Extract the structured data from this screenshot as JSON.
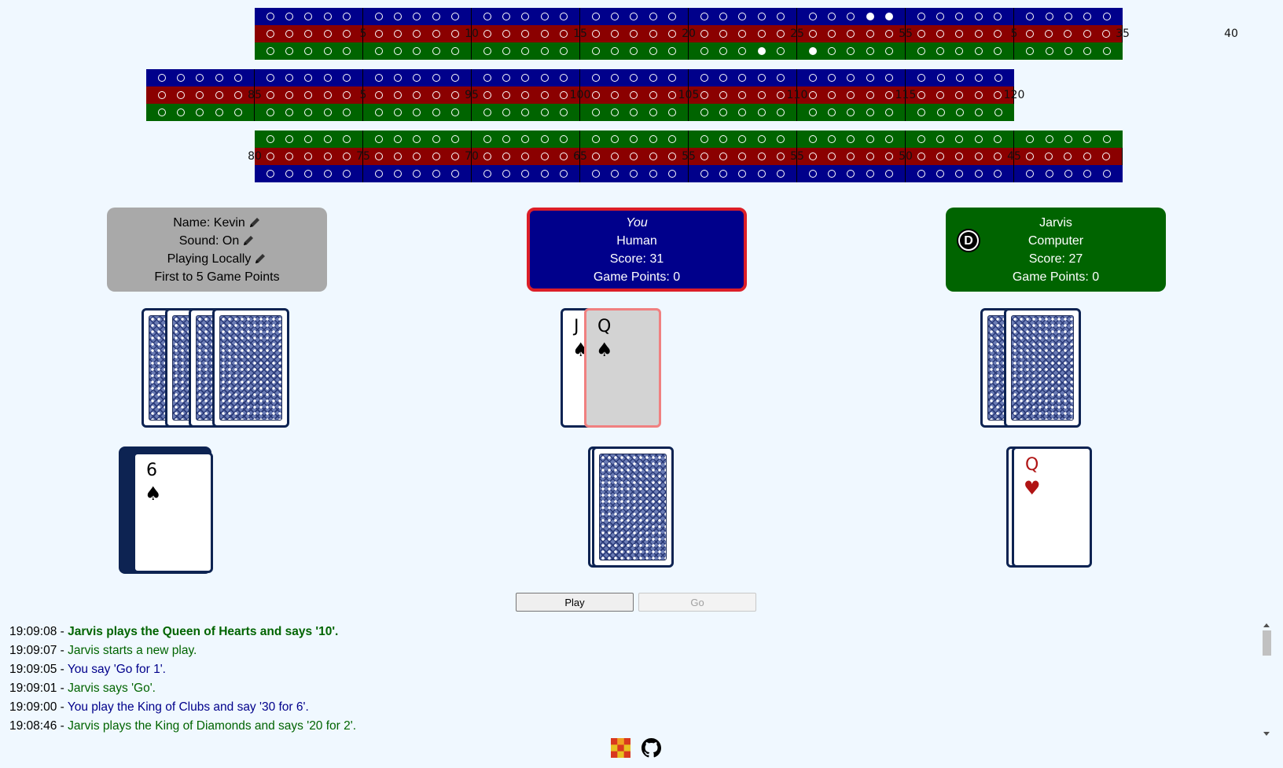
{
  "board": {
    "top": {
      "blue_pegs": [
        29,
        30
      ],
      "red_numbers": [
        "5",
        "10",
        "15",
        "20",
        "25",
        "55",
        "5",
        "35",
        "40"
      ],
      "green_pegs": [
        24,
        26
      ]
    },
    "middle": {
      "red_numbers": [
        "85",
        "5",
        "95",
        "100",
        "105",
        "110",
        "115",
        "120"
      ]
    },
    "bottom": {
      "red_numbers": [
        "80",
        "75",
        "70",
        "65",
        "55",
        "55",
        "50",
        "45"
      ]
    }
  },
  "settings": {
    "name_label": "Name: Kevin",
    "sound_label": "Sound: On",
    "mode_label": "Playing Locally",
    "goal_label": "First to 5 Game Points"
  },
  "you": {
    "title": "You",
    "type": "Human",
    "score": "Score: 31",
    "game_points": "Game Points: 0"
  },
  "jarvis": {
    "title": "Jarvis",
    "type": "Computer",
    "score": "Score: 27",
    "game_points": "Game Points: 0",
    "dealer_badge": "D"
  },
  "hand": {
    "card1": {
      "rank": "J",
      "suit": "♠"
    },
    "card2": {
      "rank": "Q",
      "suit": "♠"
    }
  },
  "crib_card": {
    "rank": "6",
    "suit": "♠"
  },
  "jarvis_play_card": {
    "rank": "Q",
    "suit": "♥"
  },
  "buttons": {
    "play": "Play",
    "go": "Go"
  },
  "log": [
    {
      "time": "19:09:08 - ",
      "msg": "Jarvis plays the Queen of Hearts and says '10'."
    },
    {
      "time": "19:09:07 - ",
      "msg": "Jarvis starts a new play."
    },
    {
      "time": "19:09:05 - ",
      "msg": "You say 'Go for 1'."
    },
    {
      "time": "19:09:01 - ",
      "msg": "Jarvis says 'Go'."
    },
    {
      "time": "19:09:00 - ",
      "msg": "You play the King of Clubs and say '30 for 6'."
    },
    {
      "time": "19:08:46 - ",
      "msg": "Jarvis plays the King of Diamonds and says '20 for 2'."
    }
  ],
  "colors": {
    "blue": "#00008b",
    "red": "#8b0000",
    "green": "#006400",
    "active_border": "#dc1e28",
    "settings_bg": "#a9a9a9",
    "card_border": "#0d2352"
  }
}
